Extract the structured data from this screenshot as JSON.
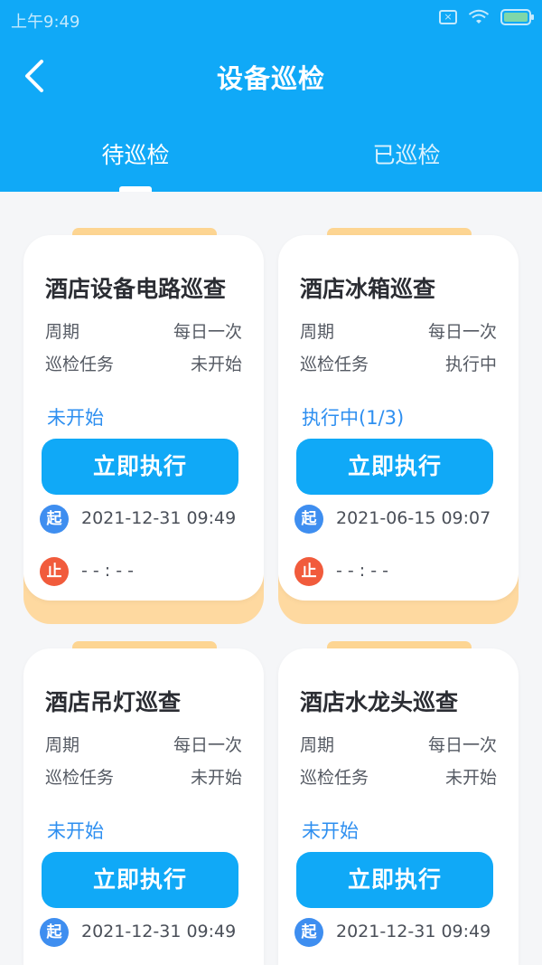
{
  "status_bar": {
    "time": "上午9:49",
    "icons": [
      "sim-x-icon",
      "wifi-icon",
      "battery-charging-icon"
    ]
  },
  "header": {
    "title": "设备巡检",
    "back_icon": "chevron-left-icon"
  },
  "tabs": [
    {
      "label": "待巡检",
      "active": true
    },
    {
      "label": "已巡检",
      "active": false
    }
  ],
  "labels": {
    "period": "周期",
    "task": "巡检任务",
    "exec_button": "立即执行",
    "start_badge": "起",
    "stop_badge": "止"
  },
  "cards": [
    {
      "title": "酒店设备电路巡查",
      "period": "每日一次",
      "task_status": "未开始",
      "status_text": "未开始",
      "start_time": "2021-12-31 09:49",
      "end_time": "- - : - -"
    },
    {
      "title": "酒店冰箱巡查",
      "period": "每日一次",
      "task_status": "执行中",
      "status_text": "执行中(1/3)",
      "start_time": "2021-06-15 09:07",
      "end_time": "- - : - -"
    },
    {
      "title": "酒店吊灯巡查",
      "period": "每日一次",
      "task_status": "未开始",
      "status_text": "未开始",
      "start_time": "2021-12-31 09:49",
      "end_time": ""
    },
    {
      "title": "酒店水龙头巡查",
      "period": "每日一次",
      "task_status": "未开始",
      "status_text": "未开始",
      "start_time": "2021-12-31 09:49",
      "end_time": ""
    }
  ],
  "colors": {
    "primary": "#10a9f7",
    "accent_orange": "#fed9a0",
    "status_blue": "#2e8ff0",
    "start_badge": "#3e8ef0",
    "stop_badge": "#f15b3c"
  }
}
